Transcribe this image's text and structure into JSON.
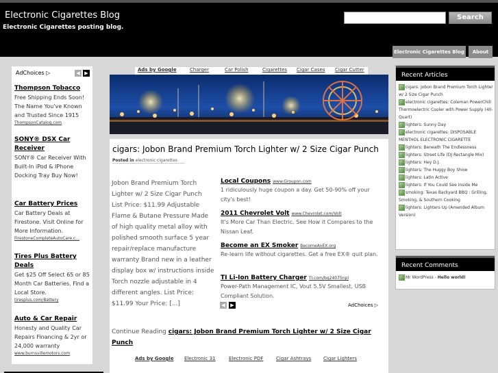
{
  "header": {
    "site_title": "Electronic Cigarettes Blog",
    "site_description": "Electronic Cigarettes posting blog.",
    "search_placeholder": "",
    "search_button": "Search",
    "nav": [
      "Electronic Cigarettes Blog",
      "About"
    ]
  },
  "left_ads": {
    "adchoices": "AdChoices",
    "ads": [
      {
        "title": "Thompson Tobacco",
        "text": "Free Shipping Ends Soon! The Name You've Known and Trusted Since 1915",
        "url": "ThompsonCatalog.com"
      },
      {
        "title": "SONY® DSX Car Receiver",
        "text": "SONY® Car Receiver With Built-In iPod & IPhone Docking Tray Buy Now!",
        "url": ""
      },
      {
        "title": "Car Battery Prices",
        "text": "Car Battery Deals at Firestone. Visit Online for More Information.",
        "url": "FirestoneCompleteAutoCare.c..."
      },
      {
        "title": "Tires Plus Battery Deals",
        "text": "Get $25 Off Select 65 or 85 Month Car Batteries. Find a Local Store.",
        "url": "tiresplus.com/Battery"
      },
      {
        "title": "Auto & Car Repair",
        "text": "Honesty and Quality Car Repairs Financing & 2yr or 24,000 warranty",
        "url": "www.burnsvillemotors.com"
      }
    ]
  },
  "ad_links_top": {
    "label": "Ads by Google",
    "links": [
      "Charger",
      "Car Polish",
      "Cigarettes",
      "Cigar Cases",
      "Cigar Cutter"
    ]
  },
  "post": {
    "title": "cigars: Jobon Brand Premium Torch Lighter w/ 2 Size Cigar Punch",
    "meta_prefix": "Posted in",
    "category": "electronic cigarettes",
    "body": "Jobon Brand Premium Torch Lighter w/ 2 Size Cigar Punch List Price: $11.99 Adjustable Flame & Butane Pressure Made of high quality metal alloy with polished smooth surface 5 year repair/replace manufacture warranty Brand new in a leather display box w/ instructions inside Torch nozzle adjustable in 4 different angles. List Price: $11.99 Your Price: [...]",
    "continue_prefix": "Continue Reading",
    "continue_link": "cigars: Jobon Brand Premium Torch Lighter w/ 2 Size Cigar Punch"
  },
  "post_ads": {
    "adchoices": "AdChoices",
    "ads": [
      {
        "title": "Local Coupons",
        "url": "www.Groupon.com",
        "text": "1 ridiculously huge coupon a day. Get 50-90% off your city's best!"
      },
      {
        "title": "2011 Chevrolet Volt",
        "url": "www.Chevrolet.com/Volt",
        "text": "It's More Car Than Electric. See How it Compares to the Nissan Leaf."
      },
      {
        "title": "Become an EX Smoker",
        "url": "BecomeAnEX.org",
        "text": "Re-learn life without cigarettes. Get a free EX® quit plan."
      },
      {
        "title": "TI Li-Ion Battery Charger",
        "url": "TI.com/bq24075npl",
        "text": "Power-Path Management IC, Vout 5.5V Smallest, USB Compliant Solution."
      }
    ]
  },
  "ad_links_bottom": {
    "label": "Ads by Google",
    "links": [
      "Electronic 31",
      "Electronic PDF",
      "Cigar Ashtrays",
      "Cigar Lighters"
    ]
  },
  "sidebar": {
    "recent_articles_title": "Recent Articles",
    "recent_articles": [
      "cigars: Jobon Brand Premium Torch Lighter w/ 2 Size Cigar Punch",
      "electronic cigarettes: Coleman PowerChill Thermoelectric Cooler with Power Supply (40-Quart)",
      "lighters: Sunny Day",
      "electronic cigarettes: DISPOSABLE MENTHOL ELECTRONIC CIGARETTE",
      "lighters: Beneath The Endlessness",
      "lighters: Street Life (DJ Rectangle Mix)",
      "lighters: Hey D.J.",
      "lighters: The Huggy Boy Show",
      "lighters: Latin Active",
      "lighters: If You Could See Inside Me",
      "smoking: Texas Backyard BBQ : Grilling, Smoking, & Southern Cooking",
      "lighters: Lighters Up (Amended Album Version)"
    ],
    "recent_comments_title": "Recent Comments",
    "recent_comment_author": "Mr WordPress",
    "recent_comment_separator": " - ",
    "recent_comment_post": "Hello world!"
  }
}
